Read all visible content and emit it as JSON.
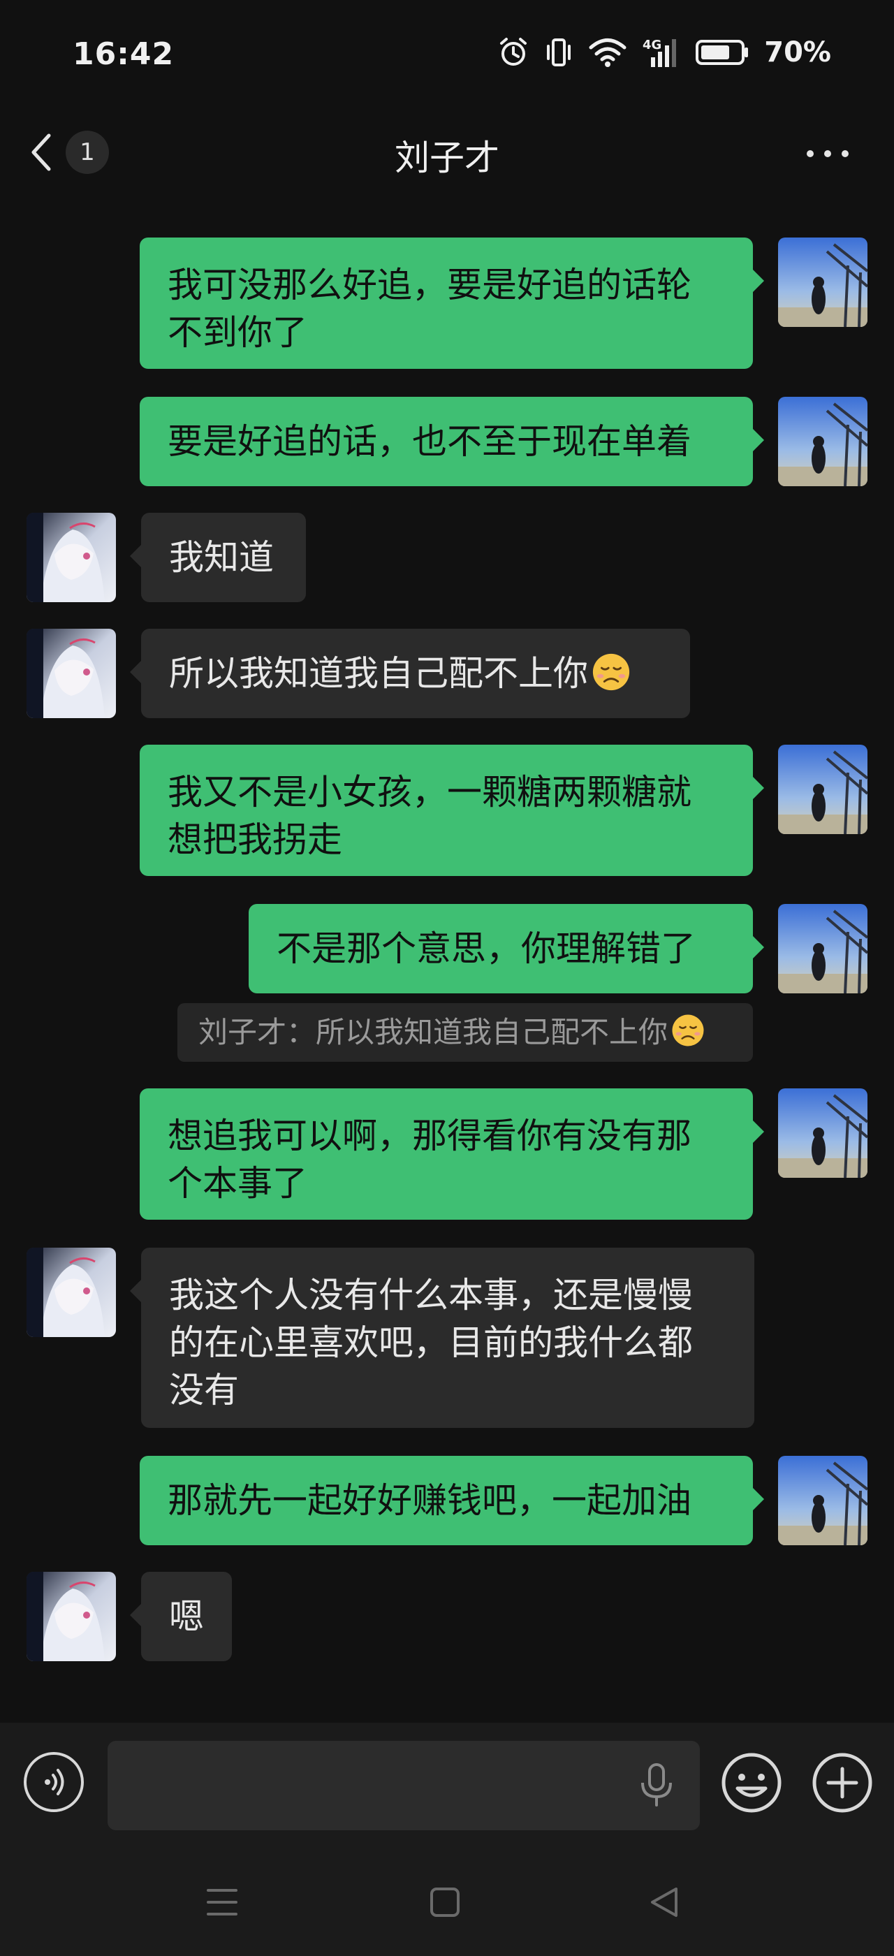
{
  "status_bar": {
    "time": "16:42",
    "network": "4G",
    "battery": "70%",
    "icons": [
      "alarm-icon",
      "vibrate-icon",
      "wifi-icon",
      "signal-icon",
      "battery-icon"
    ]
  },
  "nav": {
    "unread_count": "1",
    "title": "刘子才"
  },
  "messages": [
    {
      "from": "me",
      "text": "我可没那么好追，要是好追的话轮不到你了"
    },
    {
      "from": "me",
      "text": "要是好追的话，也不至于现在单着"
    },
    {
      "from": "them",
      "text": "我知道"
    },
    {
      "from": "them",
      "text": "所以我知道我自己配不上你"
    },
    {
      "from": "me",
      "text": "我又不是小女孩，一颗糖两颗糖就想把我拐走"
    },
    {
      "from": "me",
      "text": "不是那个意思，你理解错了",
      "quote": "刘子才：所以我知道我自己配不上你"
    },
    {
      "from": "me",
      "text": "想追我可以啊，那得看你有没有那个本事了"
    },
    {
      "from": "them",
      "text": "我这个人没有什么本事，还是慢慢的在心里喜欢吧，目前的我什么都没有"
    },
    {
      "from": "me",
      "text": "那就先一起好好赚钱吧，一起加油"
    },
    {
      "from": "them",
      "text": "嗯"
    }
  ],
  "colors": {
    "background": "#111111",
    "outgoing_bubble": "#3fbf73",
    "incoming_bubble": "#2b2b2b",
    "input_bar": "#1b1b1b"
  },
  "input": {
    "placeholder": ""
  }
}
